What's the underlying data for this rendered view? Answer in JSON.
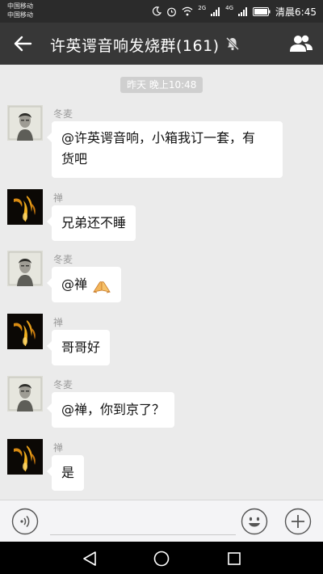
{
  "status_bar": {
    "carrier_1": "中国移动",
    "carrier_2": "中国移动",
    "network_1": "2G",
    "network_2": "4G",
    "time": "清晨6:45"
  },
  "header": {
    "title": "许英谔音响发烧群(161)",
    "back_icon": "arrow-left-icon",
    "mute_icon": "bell-off-icon",
    "members_icon": "group-people-icon"
  },
  "chat": {
    "timestamp": "昨天 晚上10:48",
    "messages": [
      {
        "sender": "冬麦",
        "text_line1": "@许英谔音响，小箱我订一套，有",
        "text_line2": "货吧"
      },
      {
        "sender": "禅",
        "text": "兄弟还不睡"
      },
      {
        "sender": "冬麦",
        "text": "@禅",
        "emoji": "praying-hands"
      },
      {
        "sender": "禅",
        "text": "哥哥好"
      },
      {
        "sender": "冬麦",
        "text": "@禅，你到京了？"
      },
      {
        "sender": "禅",
        "text": "是"
      }
    ]
  },
  "input_bar": {
    "voice_icon": "voice-icon",
    "emoji_icon": "smiley-icon",
    "plus_icon": "plus-icon"
  },
  "nav_bar": {
    "back_icon": "triangle-back-icon",
    "home_icon": "circle-home-icon",
    "recent_icon": "square-recent-icon"
  }
}
